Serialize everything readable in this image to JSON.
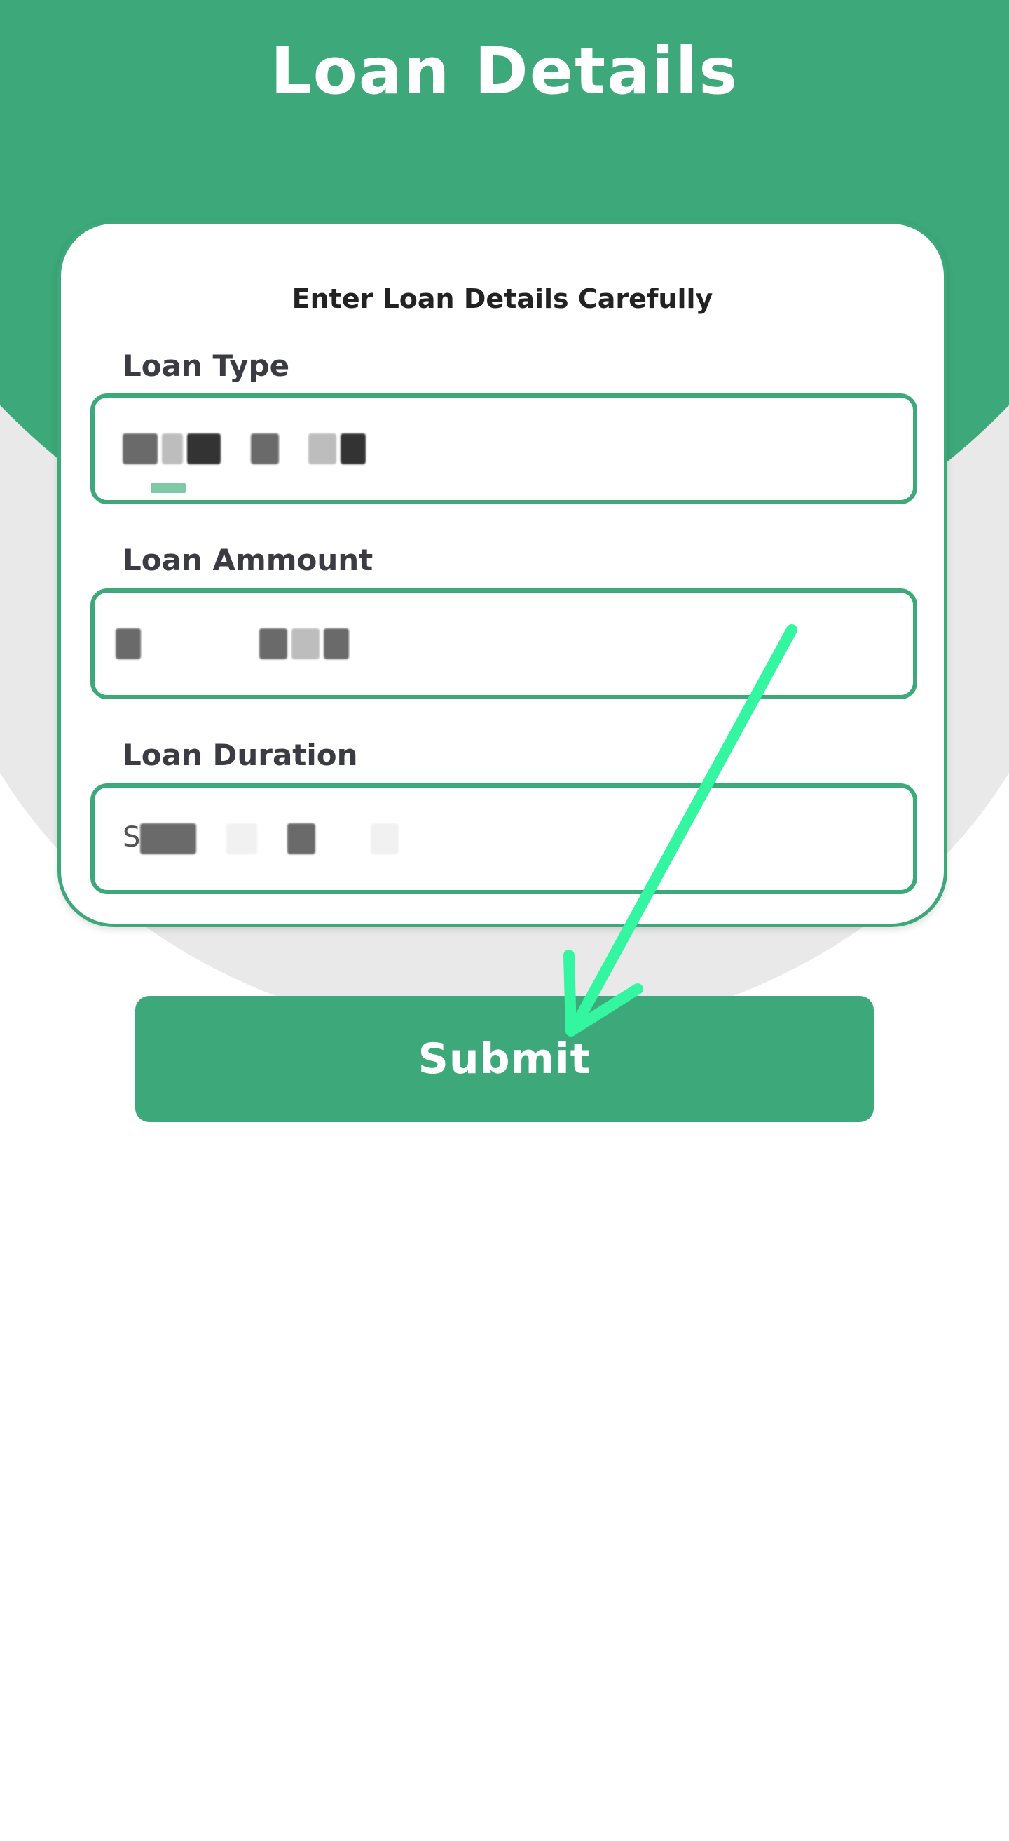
{
  "header": {
    "title": "Loan Details"
  },
  "form": {
    "subtitle": "Enter Loan Details Carefully",
    "fields": [
      {
        "label": "Loan Type",
        "value": ""
      },
      {
        "label": "Loan Ammount",
        "value": ""
      },
      {
        "label": "Loan Duration",
        "value": "S"
      }
    ]
  },
  "submit": {
    "label": "Submit"
  },
  "colors": {
    "primary_green": "#3da87a",
    "background_grey": "#e9e9e9",
    "annotation_arrow": "#34f5a0"
  },
  "icons": {
    "annotation": "arrow-down-left-icon"
  }
}
